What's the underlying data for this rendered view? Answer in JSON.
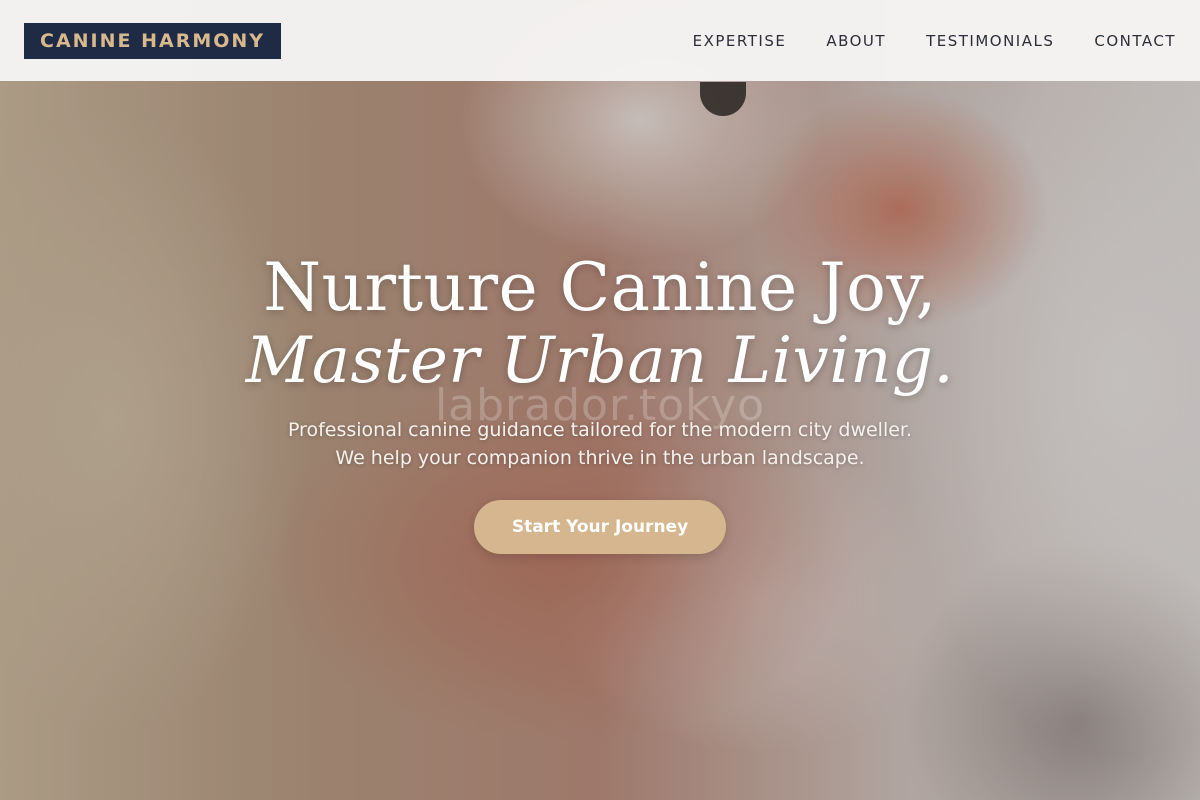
{
  "brand": {
    "name": "CANINE HARMONY",
    "colors": {
      "logo_bg": "#1f2a44",
      "logo_text": "#d8b98e",
      "accent": "#d5b68e"
    }
  },
  "nav": {
    "items": [
      {
        "label": "EXPERTISE"
      },
      {
        "label": "ABOUT"
      },
      {
        "label": "TESTIMONIALS"
      },
      {
        "label": "CONTACT"
      }
    ]
  },
  "hero": {
    "title_line1": "Nurture Canine Joy,",
    "title_line2": "Master Urban Living.",
    "subtitle_line1": "Professional canine guidance tailored for the modern city dweller.",
    "subtitle_line2": "We help your companion thrive in the urban landscape.",
    "cta_label": "Start Your Journey",
    "watermark": "labrador.tokyo"
  }
}
